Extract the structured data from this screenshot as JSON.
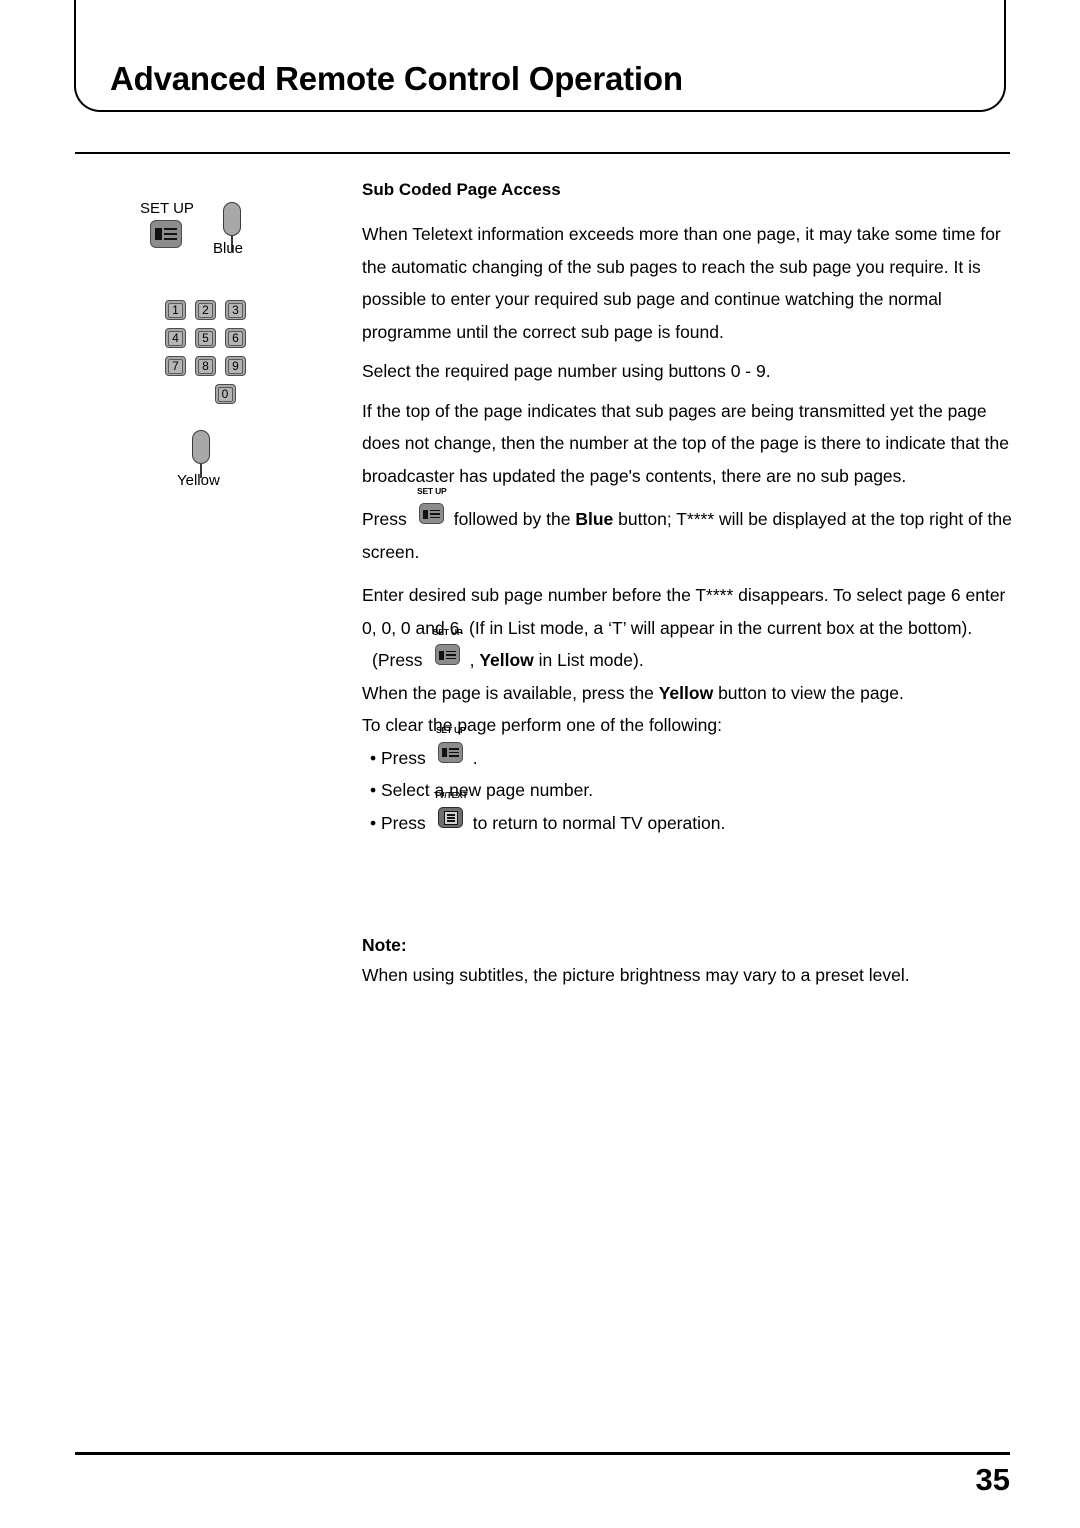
{
  "header": {
    "title": "Advanced Remote Control Operation"
  },
  "sidebar": {
    "setup_label": "SET UP",
    "setup_icon": "setup-key-icon",
    "blue_button_label": "Blue",
    "yellow_button_label": "Yellow",
    "keypad": {
      "rows": [
        [
          "1",
          "2",
          "3"
        ],
        [
          "4",
          "5",
          "6"
        ],
        [
          "7",
          "8",
          "9"
        ]
      ],
      "zero": "0"
    }
  },
  "content": {
    "heading": "Sub Coded Page Access",
    "para1": "When Teletext information exceeds more than one page, it may take some time for the automatic changing of the sub pages to reach the sub page you require. It is possible to enter your required sub page and continue watching the normal programme until the correct sub page is found.",
    "para2": "Select the required page number using buttons 0 - 9.",
    "para3": "If the top of the page indicates that sub pages are being transmitted yet the page does not change, then the number at the top of the page is there to indicate that the broadcaster has updated the page's contents, there are no sub pages.",
    "press_line": {
      "prefix": "Press",
      "icon_caption": "SET UP",
      "mid": "followed by the",
      "bold": "Blue",
      "suffix": "button; T**** will be displayed at the top right of the screen."
    },
    "para4": "Enter desired sub page number before the T**** disappears. To select page 6 enter 0, 0, 0 and 6. (If in List mode, a ‘T’ will appear in the current box at the bottom).",
    "press_yellow_line": {
      "prefix": "(Press",
      "icon_caption": "SET UP",
      "mid": ",",
      "bold": "Yellow",
      "suffix": "in List mode)."
    },
    "para5_prefix": "When the page is available, press the",
    "para5_bold": "Yellow",
    "para5_suffix": "button to view the page.",
    "para6": "To clear the page perform one of the following:",
    "bullet1": {
      "prefix": "• Press",
      "icon_caption": "SET UP",
      "suffix": "."
    },
    "bullet2": "• Select a new page number.",
    "bullet3": {
      "prefix": "• Press",
      "icon_caption": "TV/TEXT",
      "suffix": "to return to normal TV operation."
    },
    "note_title": "Note:",
    "note_text": "When using subtitles, the picture brightness may vary to a preset level."
  },
  "footer": {
    "page_number": "35"
  }
}
